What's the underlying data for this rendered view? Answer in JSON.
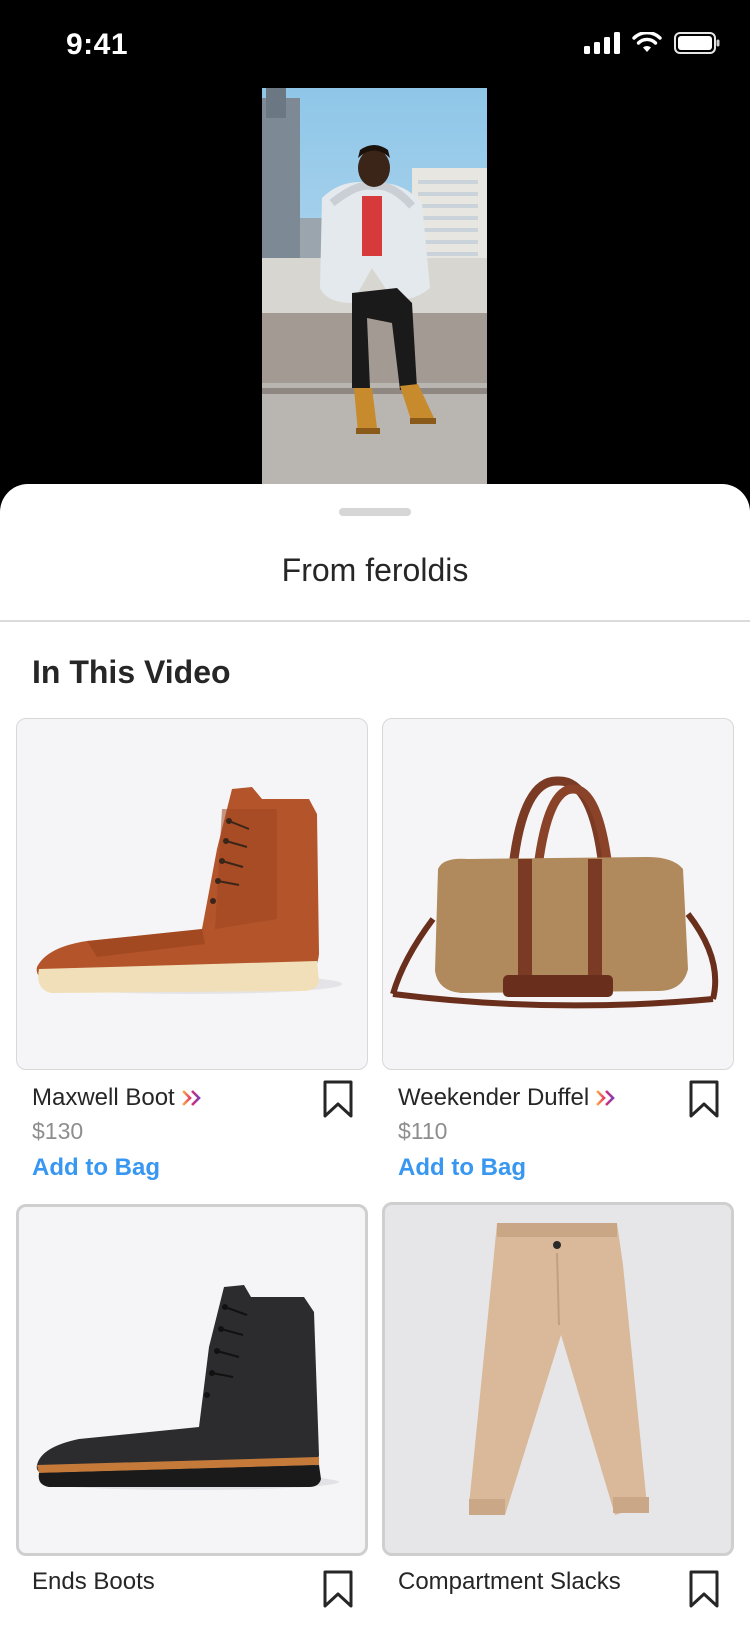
{
  "status_bar": {
    "time": "9:41"
  },
  "sheet": {
    "title": "From feroldis",
    "section_heading": "In This Video"
  },
  "products": [
    {
      "name": "Maxwell Boot",
      "price": "$130",
      "action": "Add to Bag"
    },
    {
      "name": "Weekender Duffel",
      "price": "$110",
      "action": "Add to Bag"
    },
    {
      "name": "Ends Boots"
    },
    {
      "name": "Compartment Slacks"
    }
  ],
  "colors": {
    "accent": "#3897f0",
    "brand_gradient": [
      "#fcaf45",
      "#e1306c",
      "#833ab4"
    ]
  }
}
